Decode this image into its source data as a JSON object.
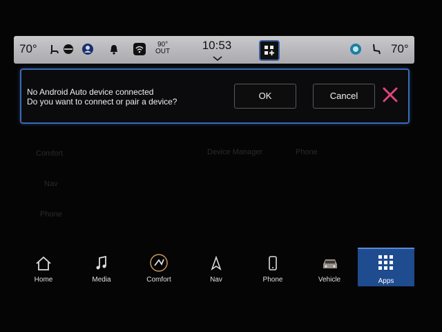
{
  "status_bar": {
    "left_temp": "70°",
    "right_temp": "70°",
    "outside_temp": "90°",
    "outside_label": "OUT",
    "clock": "10:53",
    "icons": [
      "heated-seat-icon",
      "steering-heat-icon",
      "driver-profile-icon",
      "bell-icon",
      "wifi-icon",
      "apps-grid-icon",
      "assistant-icon",
      "seat-icon"
    ]
  },
  "background_menu": {
    "items": [
      "Comfort",
      "Nav",
      "Phone",
      "Device Manager",
      "Phone"
    ]
  },
  "dialog": {
    "line1": "No Android Auto device connected",
    "line2": "Do you want to connect or pair a device?",
    "ok_label": "OK",
    "cancel_label": "Cancel",
    "close_icon": "close-icon",
    "close_color": "#e0457b",
    "border_color": "#3a6bb5"
  },
  "nav": {
    "items": [
      {
        "label": "Home",
        "icon": "home-icon"
      },
      {
        "label": "Media",
        "icon": "music-note-icon"
      },
      {
        "label": "Comfort",
        "icon": "comfort-icon"
      },
      {
        "label": "Nav",
        "icon": "navigation-arrow-icon"
      },
      {
        "label": "Phone",
        "icon": "phone-icon"
      },
      {
        "label": "Vehicle",
        "icon": "car-icon"
      },
      {
        "label": "Apps",
        "icon": "apps-grid-icon"
      }
    ],
    "active": "Apps",
    "active_color": "#1f4b8f"
  }
}
